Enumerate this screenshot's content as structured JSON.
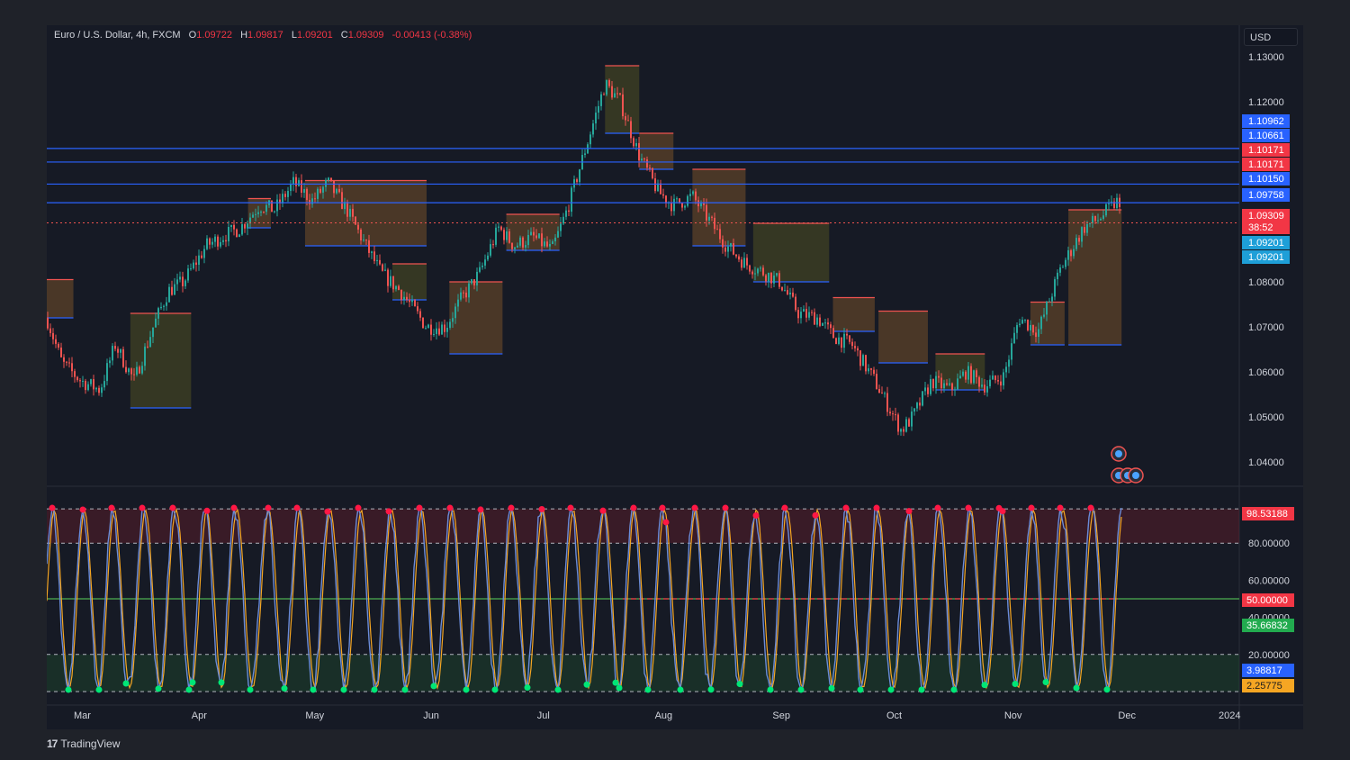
{
  "legend": {
    "symbol": "Euro / U.S. Dollar, 4h, FXCM",
    "o_key": "O",
    "o_val": "1.09722",
    "h_key": "H",
    "h_val": "1.09817",
    "l_key": "L",
    "l_val": "1.09201",
    "c_key": "C",
    "c_val": "1.09309",
    "change": "-0.00413 (-0.38%)"
  },
  "currency_button": "USD",
  "branding": {
    "tradingview": "TradingView"
  },
  "colors": {
    "background": "#161a25",
    "up": "#26a69a",
    "down": "#ef5350",
    "level_blue": "#2962ff",
    "ob_fill": "#8a5a2b",
    "osc_line": "#6a8bd8",
    "osc_signal": "#f5a623",
    "osc_red_dot": "#ff1744",
    "osc_green_dot": "#00e676"
  },
  "chart_data": [
    {
      "type": "candlestick",
      "title": "Euro / U.S. Dollar, 4h, FXCM",
      "ylim": [
        1.035,
        1.135
      ],
      "y_ticks": [
        "1.13000",
        "1.12000",
        "1.08000",
        "1.07000",
        "1.06000",
        "1.05000",
        "1.04000"
      ],
      "x_ticks": [
        "Mar",
        "Apr",
        "May",
        "Jun",
        "Jul",
        "Aug",
        "Sep",
        "Oct",
        "Nov",
        "Dec",
        "2024"
      ],
      "close_path": [
        [
          "2023-02-20",
          1.072
        ],
        [
          "2023-02-24",
          1.062
        ],
        [
          "2023-03-01",
          1.058
        ],
        [
          "2023-03-06",
          1.056
        ],
        [
          "2023-03-10",
          1.066
        ],
        [
          "2023-03-15",
          1.058
        ],
        [
          "2023-03-20",
          1.07
        ],
        [
          "2023-03-24",
          1.078
        ],
        [
          "2023-03-28",
          1.08
        ],
        [
          "2023-04-03",
          1.088
        ],
        [
          "2023-04-07",
          1.09
        ],
        [
          "2023-04-12",
          1.092
        ],
        [
          "2023-04-17",
          1.097
        ],
        [
          "2023-04-21",
          1.096
        ],
        [
          "2023-04-26",
          1.102
        ],
        [
          "2023-05-01",
          1.098
        ],
        [
          "2023-05-05",
          1.102
        ],
        [
          "2023-05-10",
          1.096
        ],
        [
          "2023-05-15",
          1.088
        ],
        [
          "2023-05-19",
          1.082
        ],
        [
          "2023-05-24",
          1.078
        ],
        [
          "2023-05-31",
          1.07
        ],
        [
          "2023-06-05",
          1.07
        ],
        [
          "2023-06-09",
          1.076
        ],
        [
          "2023-06-14",
          1.082
        ],
        [
          "2023-06-19",
          1.092
        ],
        [
          "2023-06-23",
          1.088
        ],
        [
          "2023-06-28",
          1.09
        ],
        [
          "2023-07-03",
          1.087
        ],
        [
          "2023-07-07",
          1.096
        ],
        [
          "2023-07-12",
          1.11
        ],
        [
          "2023-07-17",
          1.124
        ],
        [
          "2023-07-21",
          1.12
        ],
        [
          "2023-07-26",
          1.108
        ],
        [
          "2023-07-31",
          1.1
        ],
        [
          "2023-08-04",
          1.097
        ],
        [
          "2023-08-09",
          1.099
        ],
        [
          "2023-08-14",
          1.093
        ],
        [
          "2023-08-18",
          1.088
        ],
        [
          "2023-08-23",
          1.084
        ],
        [
          "2023-08-28",
          1.082
        ],
        [
          "2023-09-01",
          1.08
        ],
        [
          "2023-09-06",
          1.073
        ],
        [
          "2023-09-11",
          1.072
        ],
        [
          "2023-09-15",
          1.068
        ],
        [
          "2023-09-20",
          1.066
        ],
        [
          "2023-09-26",
          1.058
        ],
        [
          "2023-10-03",
          1.047
        ],
        [
          "2023-10-06",
          1.05
        ],
        [
          "2023-10-11",
          1.058
        ],
        [
          "2023-10-16",
          1.056
        ],
        [
          "2023-10-20",
          1.06
        ],
        [
          "2023-10-25",
          1.057
        ],
        [
          "2023-10-30",
          1.059
        ],
        [
          "2023-11-03",
          1.072
        ],
        [
          "2023-11-08",
          1.069
        ],
        [
          "2023-11-14",
          1.083
        ],
        [
          "2023-11-20",
          1.092
        ],
        [
          "2023-11-24",
          1.094
        ],
        [
          "2023-11-29",
          1.098
        ],
        [
          "2023-11-30",
          1.093
        ]
      ],
      "horizontal_levels": [
        1.10962,
        1.10661,
        1.10171,
        1.09758
      ],
      "current_price_line": 1.09309,
      "price_labels": [
        {
          "value": "1.10962",
          "color": "#2962ff"
        },
        {
          "value": "1.10661",
          "color": "#2962ff"
        },
        {
          "value": "1.10171",
          "color": "#f23645"
        },
        {
          "value": "1.10171",
          "color": "#f23645"
        },
        {
          "value": "1.10150",
          "color": "#2962ff"
        },
        {
          "value": "1.09758",
          "color": "#2962ff"
        },
        {
          "value": "1.09309",
          "color": "#f23645"
        },
        {
          "value": "38:52",
          "color": "#f23645"
        },
        {
          "value": "1.09201",
          "color": "#1e9fd8"
        },
        {
          "value": "1.09201",
          "color": "#1e9fd8"
        }
      ]
    },
    {
      "type": "line",
      "title": "",
      "ylim": [
        0,
        100
      ],
      "y_ticks": [
        "80.00000",
        "60.00000",
        "50.00000",
        "40.00000",
        "20.00000"
      ],
      "levels": [
        98.5,
        80,
        50,
        20,
        0
      ],
      "price_labels": [
        {
          "value": "98.53188",
          "color": "#f23645"
        },
        {
          "value": "50.00000",
          "color": "#f23645"
        },
        {
          "value": "35.66832",
          "color": "#22ab4f"
        },
        {
          "value": "3.98817",
          "color": "#2962ff"
        },
        {
          "value": "2.25775",
          "color": "#f5a623"
        }
      ]
    }
  ]
}
